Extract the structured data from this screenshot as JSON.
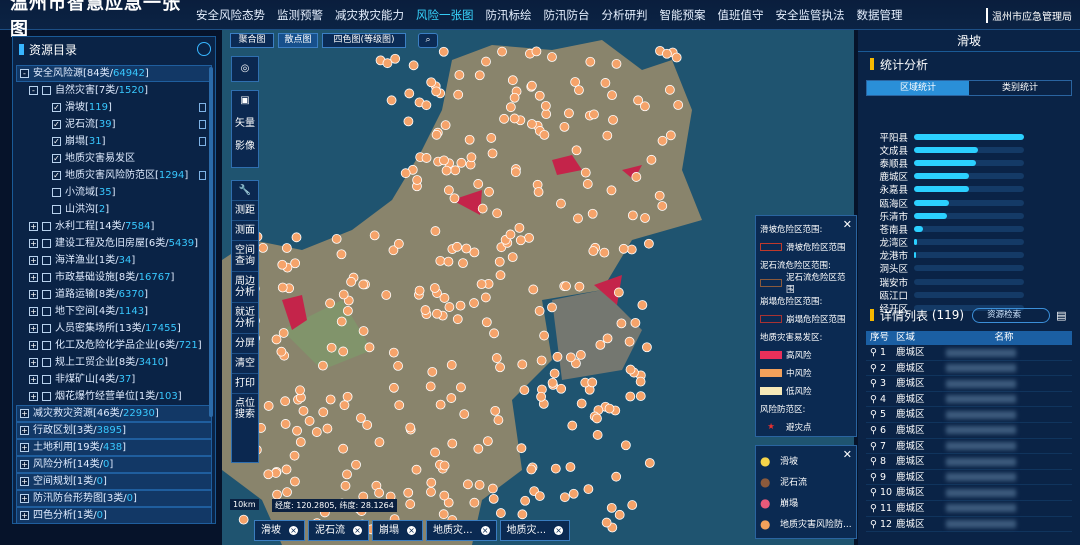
{
  "header": {
    "title": "温州市智慧应急一张图",
    "org": "温州市应急管理局",
    "nav": [
      "安全风险态势",
      "监测预警",
      "减灾救灾能力",
      "风险一张图",
      "防汛标绘",
      "防汛防台",
      "分析研判",
      "智能预案",
      "值班值守",
      "安全监管执法",
      "数据管理"
    ],
    "active_nav": "风险一张图"
  },
  "left": {
    "title": "资源目录",
    "tree": [
      {
        "label": "安全风险源[84类/",
        "count": "64942",
        "suffix": "]",
        "level": 0,
        "top": true,
        "pm": "-",
        "cb": ""
      },
      {
        "label": "自然灾害[7类/",
        "count": "1520",
        "suffix": "]",
        "level": 1,
        "pm": "-",
        "cb": ""
      },
      {
        "label": "滑坡[",
        "count": "119",
        "suffix": "]",
        "level": 2,
        "cb": "✓",
        "doc": true
      },
      {
        "label": "泥石流[",
        "count": "39",
        "suffix": "]",
        "level": 2,
        "cb": "✓",
        "doc": true
      },
      {
        "label": "崩塌[",
        "count": "31",
        "suffix": "]",
        "level": 2,
        "cb": "✓",
        "doc": true
      },
      {
        "label": "地质灾害易发区",
        "count": "",
        "suffix": "",
        "level": 2,
        "cb": "✓"
      },
      {
        "label": "地质灾害风险防范区[",
        "count": "1294",
        "suffix": "]",
        "level": 2,
        "cb": "✓",
        "doc": true
      },
      {
        "label": "小流域[",
        "count": "35",
        "suffix": "]",
        "level": 2,
        "cb": ""
      },
      {
        "label": "山洪沟[",
        "count": "2",
        "suffix": "]",
        "level": 2,
        "cb": ""
      },
      {
        "label": "水利工程[14类/",
        "count": "7584",
        "suffix": "]",
        "level": 1,
        "pm": "+",
        "cb": ""
      },
      {
        "label": "建设工程及危旧房屋[6类/",
        "count": "5439",
        "suffix": "]",
        "level": 1,
        "pm": "+",
        "cb": ""
      },
      {
        "label": "海洋渔业[1类/",
        "count": "34",
        "suffix": "]",
        "level": 1,
        "pm": "+",
        "cb": ""
      },
      {
        "label": "市政基础设施[8类/",
        "count": "16767",
        "suffix": "]",
        "level": 1,
        "pm": "+",
        "cb": ""
      },
      {
        "label": "道路运输[8类/",
        "count": "6370",
        "suffix": "]",
        "level": 1,
        "pm": "+",
        "cb": ""
      },
      {
        "label": "地下空间[4类/",
        "count": "1143",
        "suffix": "]",
        "level": 1,
        "pm": "+",
        "cb": ""
      },
      {
        "label": "人员密集场所[13类/",
        "count": "17455",
        "suffix": "]",
        "level": 1,
        "pm": "+",
        "cb": ""
      },
      {
        "label": "化工及危险化学品企业[6类/",
        "count": "721",
        "suffix": "]",
        "level": 1,
        "pm": "+",
        "cb": ""
      },
      {
        "label": "规上工贸企业[8类/",
        "count": "3410",
        "suffix": "]",
        "level": 1,
        "pm": "+",
        "cb": ""
      },
      {
        "label": "非煤矿山[4类/",
        "count": "37",
        "suffix": "]",
        "level": 1,
        "pm": "+",
        "cb": ""
      },
      {
        "label": "烟花爆竹经营单位[1类/",
        "count": "103",
        "suffix": "]",
        "level": 1,
        "pm": "+",
        "cb": ""
      },
      {
        "label": "减灾救灾资源[46类/",
        "count": "22930",
        "suffix": "]",
        "level": 0,
        "top": true,
        "pm": "+",
        "cb": ""
      },
      {
        "label": "行政区划[3类/",
        "count": "3895",
        "suffix": "]",
        "level": 0,
        "top": true,
        "pm": "+",
        "cb": ""
      },
      {
        "label": "土地利用[19类/",
        "count": "438",
        "suffix": "]",
        "level": 0,
        "top": true,
        "pm": "+",
        "cb": ""
      },
      {
        "label": "风险分析[14类/",
        "count": "0",
        "suffix": "]",
        "level": 0,
        "top": true,
        "pm": "+",
        "cb": ""
      },
      {
        "label": "空间规划[1类/",
        "count": "0",
        "suffix": "]",
        "level": 0,
        "top": true,
        "pm": "+",
        "cb": ""
      },
      {
        "label": "防汛防台形势图[3类/",
        "count": "0",
        "suffix": "]",
        "level": 0,
        "top": true,
        "pm": "+",
        "cb": ""
      },
      {
        "label": "四色分析[1类/",
        "count": "0",
        "suffix": "]",
        "level": 0,
        "top": true,
        "pm": "+",
        "cb": ""
      }
    ]
  },
  "map": {
    "modes": [
      "聚合图",
      "散点图",
      "四色图(等级图)"
    ],
    "active_mode": "散点图",
    "tools": [
      "矢量",
      "影像",
      "测距",
      "测面",
      "空间查询",
      "周边分析",
      "就近分析",
      "分屏",
      "清空",
      "打印",
      "点位搜索"
    ],
    "scale": "10km",
    "coords": "经度: 120.2805, 纬度: 28.1264",
    "legend1": {
      "items": [
        {
          "type": "h",
          "text": "滑坡危险区范围:"
        },
        {
          "type": "sw",
          "text": "滑坡危险区范围",
          "color": "#c0392b",
          "outline": true
        },
        {
          "type": "h",
          "text": "泥石流危险区范围:"
        },
        {
          "type": "sw",
          "text": "泥石流危险区范围",
          "color": "#8b5a3c",
          "outline": true
        },
        {
          "type": "h",
          "text": "崩塌危险区范围:"
        },
        {
          "type": "sw",
          "text": "崩塌危险区范围",
          "color": "#a83232",
          "outline": true
        },
        {
          "type": "h",
          "text": "地质灾害易发区:"
        },
        {
          "type": "sw",
          "text": "高风险",
          "color": "#e8305a"
        },
        {
          "type": "sw",
          "text": "中风险",
          "color": "#f2a15b"
        },
        {
          "type": "sw",
          "text": "低风险",
          "color": "#f6e9b8"
        },
        {
          "type": "h",
          "text": "风险防范区:"
        },
        {
          "type": "dot",
          "text": "避灾点",
          "color": "#e83030"
        }
      ]
    },
    "legend2": [
      "滑坡",
      "泥石流",
      "崩塌",
      "地质灾害风险防..."
    ],
    "bottom_tabs": [
      "滑坡",
      "泥石流",
      "崩塌",
      "地质灾...",
      "地质灾..."
    ]
  },
  "right": {
    "title": "滑坡",
    "stats_title": "统计分析",
    "tabs": [
      "区域统计",
      "类别统计"
    ],
    "active_tab": "区域统计",
    "regions": [
      {
        "name": "平阳县",
        "v": 1.0
      },
      {
        "name": "文成县",
        "v": 0.58
      },
      {
        "name": "泰顺县",
        "v": 0.56
      },
      {
        "name": "鹿城区",
        "v": 0.5
      },
      {
        "name": "永嘉县",
        "v": 0.5
      },
      {
        "name": "瓯海区",
        "v": 0.32
      },
      {
        "name": "乐清市",
        "v": 0.3
      },
      {
        "name": "苍南县",
        "v": 0.08
      },
      {
        "name": "龙湾区",
        "v": 0.03
      },
      {
        "name": "龙港市",
        "v": 0.02
      },
      {
        "name": "洞头区",
        "v": 0.0
      },
      {
        "name": "瑞安市",
        "v": 0.0
      },
      {
        "name": "瓯江口",
        "v": 0.0
      },
      {
        "name": "经开区",
        "v": 0.0
      }
    ],
    "detail_title": "详情列表",
    "detail_count": "(119)",
    "detail_search": "资源检索",
    "columns": [
      "序号",
      "区域",
      "名称"
    ],
    "rows": [
      {
        "n": "1",
        "area": "鹿城区"
      },
      {
        "n": "2",
        "area": "鹿城区"
      },
      {
        "n": "3",
        "area": "鹿城区"
      },
      {
        "n": "4",
        "area": "鹿城区"
      },
      {
        "n": "5",
        "area": "鹿城区"
      },
      {
        "n": "6",
        "area": "鹿城区"
      },
      {
        "n": "7",
        "area": "鹿城区"
      },
      {
        "n": "8",
        "area": "鹿城区"
      },
      {
        "n": "9",
        "area": "鹿城区"
      },
      {
        "n": "10",
        "area": "鹿城区"
      },
      {
        "n": "11",
        "area": "鹿城区"
      },
      {
        "n": "12",
        "area": "鹿城区"
      }
    ]
  }
}
